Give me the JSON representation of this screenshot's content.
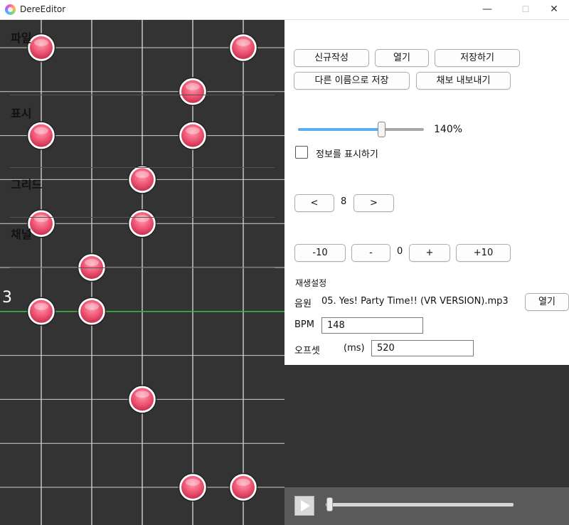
{
  "window": {
    "title": "DereEditor",
    "minimize": "—",
    "maximize": "☐",
    "close": "✕"
  },
  "chart": {
    "measure_label": "3",
    "grid_color": "#cfcfcf",
    "marker_line_color": "#38b838",
    "note_color": "#f05a78",
    "lanes": [
      1,
      2,
      3,
      4,
      5
    ],
    "notes": [
      {
        "row": 0,
        "lane": 1
      },
      {
        "row": 0,
        "lane": 5
      },
      {
        "row": 1,
        "lane": 4
      },
      {
        "row": 2,
        "lane": 1
      },
      {
        "row": 2,
        "lane": 4
      },
      {
        "row": 3,
        "lane": 3
      },
      {
        "row": 4,
        "lane": 1
      },
      {
        "row": 4,
        "lane": 3
      },
      {
        "row": 5,
        "lane": 2
      },
      {
        "row": 6,
        "lane": 1
      },
      {
        "row": 6,
        "lane": 2
      },
      {
        "row": 8,
        "lane": 3
      },
      {
        "row": 10,
        "lane": 4
      },
      {
        "row": 10,
        "lane": 5
      }
    ],
    "measure_row": 6
  },
  "file": {
    "title": "파일",
    "new": "신규작성",
    "open": "열기",
    "save": "저장하기",
    "save_as": "다른 이름으로 저장",
    "export": "채보 내보내기"
  },
  "display": {
    "title": "표시",
    "zoom_label": "140%",
    "zoom_fraction": 0.66,
    "show_info_label": "정보를 표시하기",
    "show_info_checked": false,
    "accent": "#5aaef0"
  },
  "grid": {
    "title": "그리드",
    "prev": "<",
    "value": "8",
    "next": ">"
  },
  "channel": {
    "title": "채널",
    "minus10": "-10",
    "minus": "-",
    "value": "0",
    "plus": "+",
    "plus10": "+10"
  },
  "playback": {
    "title": "재생설정",
    "audio_label": "음원",
    "audio_file": "05. Yes! Party Time!! (VR VERSION).mp3",
    "audio_open": "열기",
    "bpm_label": "BPM",
    "bpm_value": "148",
    "offset_label": "오프셋",
    "offset_unit": "(ms)",
    "offset_value": "520",
    "seek_fraction": 0.01
  }
}
